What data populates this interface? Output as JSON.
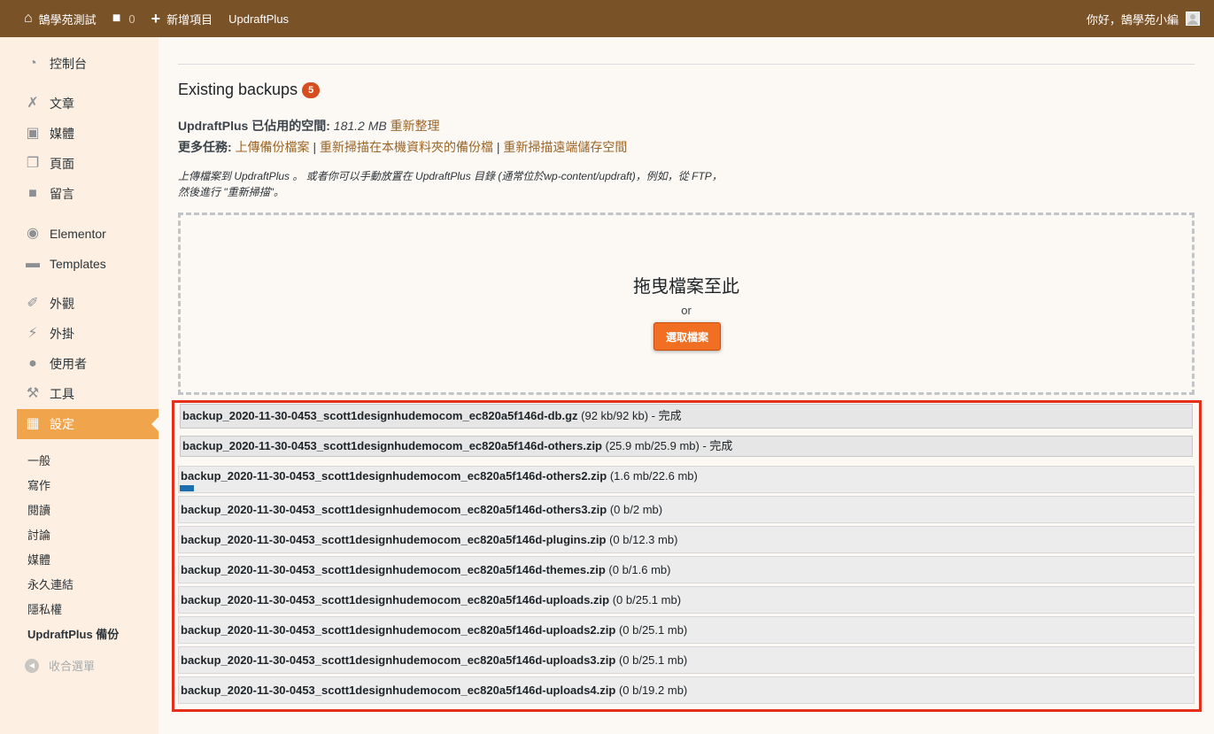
{
  "admin_bar": {
    "site_name": "鵠學苑測試",
    "comments_count": "0",
    "new_item": "新增項目",
    "plugin": "UpdraftPlus",
    "greeting": "你好，鵠學苑小編"
  },
  "sidebar": {
    "items": [
      {
        "label": "控制台",
        "icon": "dashboard-icon"
      },
      {
        "label": "文章",
        "icon": "pin-icon"
      },
      {
        "label": "媒體",
        "icon": "media-icon"
      },
      {
        "label": "頁面",
        "icon": "page-icon"
      },
      {
        "label": "留言",
        "icon": "comment-icon"
      },
      {
        "label": "Elementor",
        "icon": "elementor-icon"
      },
      {
        "label": "Templates",
        "icon": "folder-icon"
      },
      {
        "label": "外觀",
        "icon": "brush-icon"
      },
      {
        "label": "外掛",
        "icon": "plugin-icon"
      },
      {
        "label": "使用者",
        "icon": "user-icon"
      },
      {
        "label": "工具",
        "icon": "wrench-icon"
      },
      {
        "label": "設定",
        "icon": "settings-icon"
      }
    ],
    "sub_items": [
      "一般",
      "寫作",
      "閱讀",
      "討論",
      "媒體",
      "永久連結",
      "隱私權",
      "UpdraftPlus 備份"
    ],
    "collapse": "收合選單"
  },
  "main": {
    "title": "Existing backups",
    "count": "5",
    "space_label": "UpdraftPlus 已佔用的空間:",
    "space_value": "181.2 MB",
    "refresh_link": "重新整理",
    "more_tasks_label": "更多任務:",
    "task_upload": "上傳備份檔案",
    "task_rescan_local": "重新掃描在本機資料夾的備份檔",
    "task_rescan_remote": "重新掃描遠端儲存空間",
    "separator": " | ",
    "note": "上傳檔案到 UpdraftPlus 。 或者你可以手動放置在 UpdraftPlus 目錄 (通常位於wp-content/updraft)，例如，從 FTP，然後進行 \"重新掃描\"。",
    "dropzone_title": "拖曳檔案至此",
    "dropzone_or": "or",
    "dropzone_button": "選取檔案"
  },
  "uploads": [
    {
      "file": "backup_2020-11-30-0453_scott1designhudemocom_ec820a5f146d-db.gz",
      "status": " (92 kb/92 kb) - 完成",
      "progress": 1.0
    },
    {
      "file": "backup_2020-11-30-0453_scott1designhudemocom_ec820a5f146d-others.zip",
      "status": " (25.9 mb/25.9 mb) - 完成",
      "progress": 1.0
    },
    {
      "file": "backup_2020-11-30-0453_scott1designhudemocom_ec820a5f146d-others2.zip",
      "status": " (1.6 mb/22.6 mb)",
      "progress": 0.07
    },
    {
      "file": "backup_2020-11-30-0453_scott1designhudemocom_ec820a5f146d-others3.zip",
      "status": " (0 b/2 mb)",
      "progress": 0
    },
    {
      "file": "backup_2020-11-30-0453_scott1designhudemocom_ec820a5f146d-plugins.zip",
      "status": " (0 b/12.3 mb)",
      "progress": 0
    },
    {
      "file": "backup_2020-11-30-0453_scott1designhudemocom_ec820a5f146d-themes.zip",
      "status": " (0 b/1.6 mb)",
      "progress": 0
    },
    {
      "file": "backup_2020-11-30-0453_scott1designhudemocom_ec820a5f146d-uploads.zip",
      "status": " (0 b/25.1 mb)",
      "progress": 0
    },
    {
      "file": "backup_2020-11-30-0453_scott1designhudemocom_ec820a5f146d-uploads2.zip",
      "status": " (0 b/25.1 mb)",
      "progress": 0
    },
    {
      "file": "backup_2020-11-30-0453_scott1designhudemocom_ec820a5f146d-uploads3.zip",
      "status": " (0 b/25.1 mb)",
      "progress": 0
    },
    {
      "file": "backup_2020-11-30-0453_scott1designhudemocom_ec820a5f146d-uploads4.zip",
      "status": " (0 b/19.2 mb)",
      "progress": 0
    }
  ],
  "colors": {
    "admin_bar": "#7a5228",
    "active_menu": "#f0a44b",
    "accent_button": "#f16f22",
    "highlight_border": "#e52f1a",
    "progress": "#1b6fac"
  }
}
